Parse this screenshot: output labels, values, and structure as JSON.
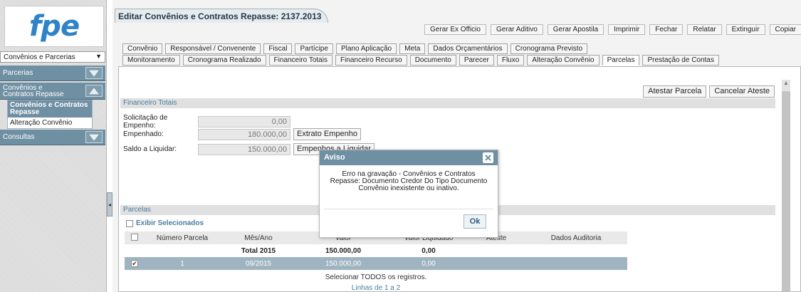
{
  "brand": {
    "logo": "fpe"
  },
  "sidebar": {
    "module": "Convênios e Parcerias",
    "groups": [
      {
        "label": "Parcerias",
        "toggle": "expand"
      },
      {
        "label": "Convênios e Contratos Repasse",
        "toggle": "collapse",
        "items": [
          "Convênios e Contratos Repasse",
          "Alteração Convênio"
        ]
      },
      {
        "label": "Consultas",
        "toggle": "expand"
      }
    ]
  },
  "window": {
    "title": "Editar Convênios e Contratos Repasse: 2137.2013"
  },
  "toolbar": [
    "Gerar Ex Officio",
    "Gerar Aditivo",
    "Gerar Apostila",
    "Imprimir",
    "Fechar",
    "Relatar",
    "Extinguir",
    "Copiar"
  ],
  "tabs_row1": [
    "Convênio",
    "Responsável / Convenente",
    "Fiscal",
    "Partícipe",
    "Plano Aplicação",
    "Meta",
    "Dados Orçamentários",
    "Cronograma Previsto"
  ],
  "tabs_row2": [
    "Monitoramento",
    "Cronograma Realizado",
    "Financeiro Totais",
    "Financeiro Recurso",
    "Documento",
    "Parecer",
    "Fluxo",
    "Alteração Convênio",
    "Parcelas",
    "Prestação de Contas"
  ],
  "active_tab": "Parcelas",
  "actions": {
    "atestar": "Atestar Parcela",
    "cancelar": "Cancelar Ateste"
  },
  "financeiro": {
    "title": "Financeiro Totais",
    "solicitacao_label": "Solicitação de Empenho:",
    "solicitacao_value": "0,00",
    "empenhado_label": "Empenhado:",
    "empenhado_value": "180.000,00",
    "extrato_button": "Extrato Empenho",
    "saldo_label": "Saldo a Liquidar:",
    "saldo_value": "150.000,00",
    "empenhos_button": "Empenhos a Liquidar"
  },
  "parcelas": {
    "title": "Parcelas",
    "exibir": "Exibir Selecionados",
    "columns": [
      "Número Parcela",
      "Mês/Ano",
      "Valor",
      "Valor Liquidado",
      "Ateste",
      "Dados Auditoria"
    ],
    "total_row": {
      "label": "Total 2015",
      "valor": "150.000,00",
      "liquidado": "0,00"
    },
    "rows": [
      {
        "checked": true,
        "numero": "1",
        "mes_ano": "09/2015",
        "valor": "150.000,00",
        "liquidado": "0,00",
        "ateste": "",
        "auditoria": ""
      }
    ],
    "select_all": "Selecionar TODOS os registros.",
    "lines_info": "Linhas de 1 a 2"
  },
  "modal": {
    "title": "Aviso",
    "message": "Erro na gravação - Convênios e Contratos Repasse: Documento Credor Do Tipo Documento Convênio inexistente ou inativo.",
    "ok": "Ok"
  },
  "colors": {
    "accent": "#6f8fa3",
    "logo": "#2f83c6",
    "link": "#4a7ca0"
  }
}
